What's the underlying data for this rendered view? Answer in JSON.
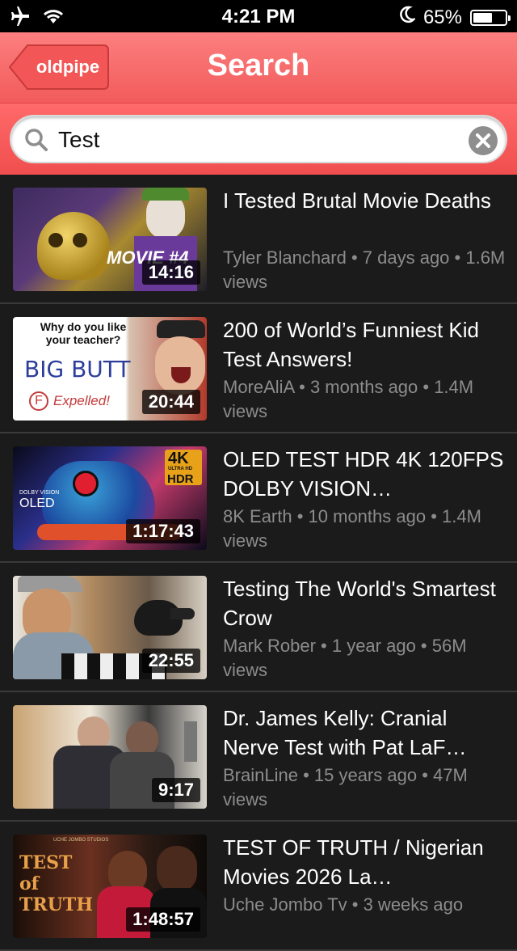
{
  "status_bar": {
    "time": "4:21 PM",
    "battery_text": "65%",
    "battery_level": 0.65
  },
  "nav": {
    "back_label": "oldpipe",
    "title": "Search"
  },
  "search": {
    "query": "Test"
  },
  "results": [
    {
      "title": "I Tested Brutal Movie Deaths",
      "meta": "Tyler Blanchard • 7 days ago • 1.6M views",
      "duration": "14:16",
      "thumb_text": "MOVIE #4"
    },
    {
      "title": "200 of World’s Funniest Kid Test Answers!",
      "meta": "MoreAliA • 3 months ago • 1.4M views",
      "duration": "20:44",
      "thumb_text": "Why do you like your teacher?",
      "thumb_text2": "BIG BUTT",
      "thumb_text3": "Expelled!"
    },
    {
      "title": "OLED TEST HDR 4K 120FPS DOLBY VISION…",
      "meta": "8K Earth • 10 months ago • 1.4M views",
      "duration": "1:17:43",
      "thumb_text": "OLED",
      "thumb_text2": "4K",
      "thumb_text3": "HDR",
      "thumb_text4": "DOLBY VISION",
      "thumb_text5": "ULTRA HD"
    },
    {
      "title": "Testing The World's Smartest Crow",
      "meta": "Mark Rober • 1 year ago • 56M views",
      "duration": "22:55"
    },
    {
      "title": "Dr. James Kelly: Cranial Nerve Test with Pat LaF…",
      "meta": "BrainLine • 15 years ago • 47M views",
      "duration": "9:17"
    },
    {
      "title": "TEST OF TRUTH / Nigerian Movies 2026 La…",
      "meta": "Uche Jombo Tv • 3 weeks ago",
      "duration": "1:48:57",
      "thumb_text": "TEST of TRUTH",
      "thumb_text2": "UCHE JOMBO STUDIOS"
    }
  ]
}
